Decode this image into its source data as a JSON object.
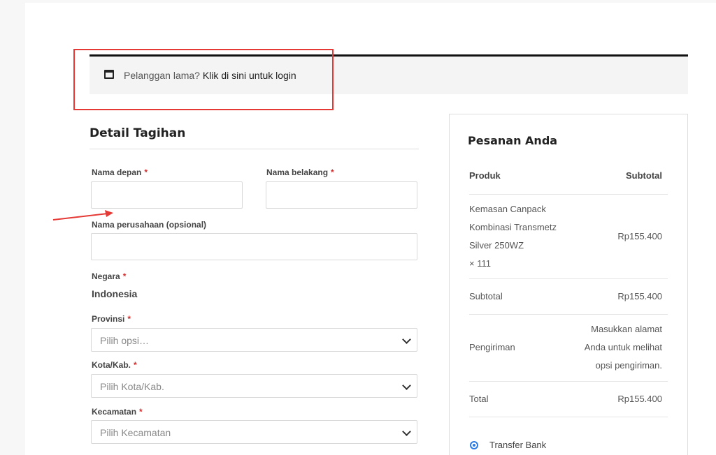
{
  "login": {
    "prompt": "Pelanggan lama?",
    "link": "Klik di sini untuk login"
  },
  "billing": {
    "title": "Detail Tagihan",
    "first_name_label": "Nama depan",
    "last_name_label": "Nama belakang",
    "company_label": "Nama perusahaan (opsional)",
    "country_label": "Negara",
    "country_value": "Indonesia",
    "province_label": "Provinsi",
    "province_placeholder": "Pilih opsi…",
    "city_label": "Kota/Kab.",
    "city_placeholder": "Pilih Kota/Kab.",
    "district_label": "Kecamatan",
    "district_placeholder": "Pilih Kecamatan",
    "required_mark": "*"
  },
  "order": {
    "title": "Pesanan Anda",
    "col_product": "Produk",
    "col_subtotal": "Subtotal",
    "item_line1": "Kemasan Canpack",
    "item_line2": "Kombinasi Transmetz",
    "item_line3": "Silver 250WZ",
    "item_qty": "× 111",
    "item_price": "Rp155.400",
    "subtotal_label": "Subtotal",
    "subtotal_value": "Rp155.400",
    "shipping_label": "Pengiriman",
    "shipping_line1": "Masukkan alamat",
    "shipping_line2": "Anda untuk melihat",
    "shipping_line3": "opsi pengiriman.",
    "total_label": "Total",
    "total_value": "Rp155.400",
    "payment_method": "Transfer Bank"
  },
  "colors": {
    "highlight": "#e53935",
    "required": "#d32f2f",
    "radio": "#2b7be4"
  }
}
